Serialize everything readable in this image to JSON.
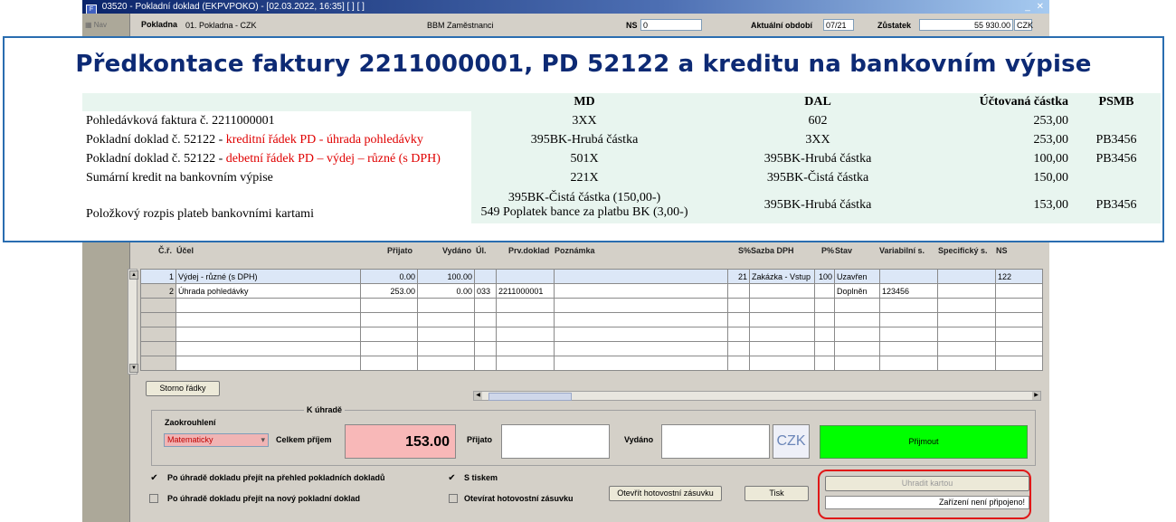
{
  "window": {
    "title": "03520 - Pokladní doklad (EKPVPOKO) - [02.03.2022, 16:35] [ ] [ ]",
    "controls": "_ ✕"
  },
  "sidebar": {
    "nav_label": "Nav"
  },
  "header": {
    "pokladna_label": "Pokladna",
    "pokladna_value": "01. Pokladna - CZK",
    "group_value": "BBM Zaměstnanci",
    "ns_label": "NS",
    "ns_value": "0",
    "period_label": "Aktuální období",
    "period_value": "07/21",
    "balance_label": "Zůstatek",
    "balance_value": "55 930.00",
    "balance_currency": "CZK"
  },
  "overlay": {
    "title": "Předkontace faktury 2211000001, PD 52122 a kreditu na bankovním výpise",
    "columns": [
      "",
      "MD",
      "DAL",
      "Účtovaná částka",
      "PSMB"
    ],
    "rows": [
      {
        "desc": "Pohledávková faktura č. 2211000001",
        "desc_red": "",
        "md": "3XX",
        "md2": "",
        "dal": "602",
        "amount": "253,00",
        "psmb": ""
      },
      {
        "desc": "Pokladní doklad č. 52122 - ",
        "desc_red": "kreditní řádek PD - úhrada pohledávky",
        "md": "395BK-Hrubá částka",
        "md2": "",
        "dal": "3XX",
        "amount": "253,00",
        "psmb": "PB3456"
      },
      {
        "desc": "Pokladní doklad č. 52122 - ",
        "desc_red": "debetní řádek PD – výdej – různé (s DPH)",
        "md": "501X",
        "md2": "",
        "dal": "395BK-Hrubá částka",
        "amount": "100,00",
        "psmb": "PB3456"
      },
      {
        "desc": "Sumární kredit na bankovním výpise",
        "desc_red": "",
        "md": "221X",
        "md2": "",
        "dal": "395BK-Čistá částka",
        "amount": "150,00",
        "psmb": ""
      },
      {
        "desc": "Položkový rozpis plateb bankovními kartami",
        "desc_red": "",
        "md": "395BK-Čistá částka (150,00-)",
        "md2": "549 Poplatek bance za platbu BK  (3,00-)",
        "dal": "395BK-Hrubá částka",
        "amount": "153,00",
        "psmb": "PB3456"
      }
    ]
  },
  "grid": {
    "headers": {
      "cr": "Č.ř.",
      "ucel": "Účel",
      "prijato": "Přijato",
      "vydano": "Vydáno",
      "ul": "Úl.",
      "prv": "Prv.doklad",
      "poznamka": "Poznámka",
      "spct": "S%",
      "sazba": "Sazba DPH",
      "ppct": "P%",
      "stav": "Stav",
      "vs": "Variabilní s.",
      "ss": "Specifický s.",
      "ns": "NS"
    },
    "rows": [
      {
        "no": "1",
        "ucel": "Výdej - různé (s DPH)",
        "prijato": "0.00",
        "vydano": "100.00",
        "ul": "",
        "prv": "",
        "pozn": "",
        "spct": "21",
        "sazba": "Zakázka - Vstup",
        "ppct": "100",
        "stav": "Uzavřen",
        "vs": "",
        "ss": "",
        "ns": "122"
      },
      {
        "no": "2",
        "ucel": "Úhrada pohledávky",
        "prijato": "253.00",
        "vydano": "0.00",
        "ul": "033",
        "prv": "2211000001",
        "pozn": "",
        "spct": "",
        "sazba": "",
        "ppct": "",
        "stav": "Doplněn",
        "vs": "123456",
        "ss": "",
        "ns": ""
      }
    ]
  },
  "buttons": {
    "storno": "Storno řádky",
    "open_drawer": "Otevřít hotovostní zásuvku",
    "print": "Tisk",
    "accept": "Přijmout",
    "pay_card": "Uhradit kartou"
  },
  "payment": {
    "section_title": "K úhradě",
    "rounding_label": "Zaokrouhlení",
    "rounding_value": "Matematicky",
    "total_label": "Celkem příjem",
    "total_value": "153.00",
    "received_label": "Přijato",
    "received_value": "",
    "issued_label": "Vydáno",
    "issued_value": "",
    "currency": "CZK"
  },
  "options": {
    "after_overview": "Po úhradě dokladu přejít na přehled pokladních dokladů",
    "after_new": "Po úhradě dokladu přejít na nový pokladní doklad",
    "with_print": "S tiskem",
    "open_drawer_opt": "Otevírat hotovostní zásuvku"
  },
  "device_status": "Zařízení není připojeno!",
  "colors": {
    "overlay_border": "#2a6db0",
    "title_blue": "#0d2a74",
    "accept_green": "#00ff00",
    "total_pink": "#f8b8b8",
    "highlight_red": "#e01818"
  }
}
